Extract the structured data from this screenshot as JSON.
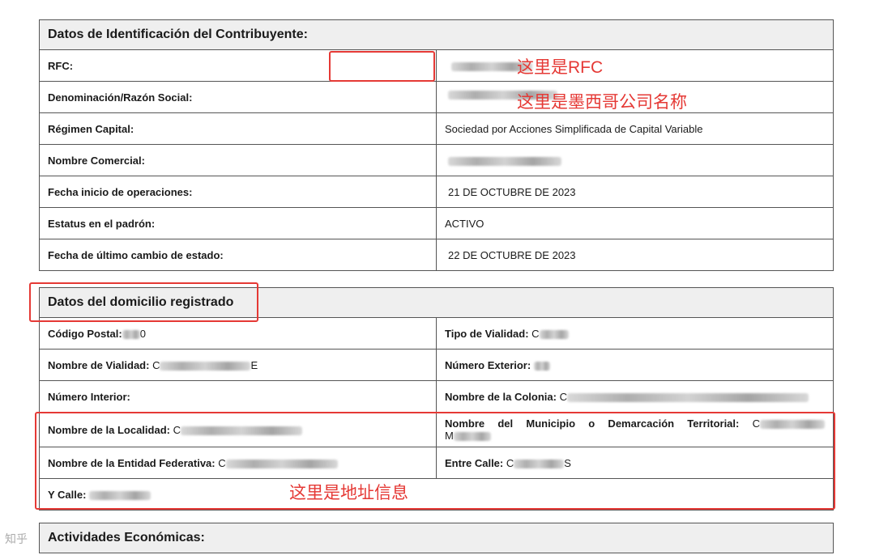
{
  "section1": {
    "title": "Datos de Identificación del Contribuyente:",
    "rows": [
      {
        "label": "RFC:",
        "value": ""
      },
      {
        "label": "Denominación/Razón Social:",
        "value": ""
      },
      {
        "label": "Régimen Capital:",
        "value": "Sociedad por Acciones Simplificada de Capital Variable"
      },
      {
        "label": "Nombre Comercial:",
        "value": ""
      },
      {
        "label": "Fecha inicio de operaciones:",
        "value": "21 DE OCTUBRE DE 2023"
      },
      {
        "label": "Estatus en el padrón:",
        "value": "ACTIVO"
      },
      {
        "label": "Fecha de último cambio de estado:",
        "value": "22 DE OCTUBRE DE 2023"
      }
    ]
  },
  "section2": {
    "title": "Datos del domicilio registrado",
    "rows": [
      {
        "left_label": "Código Postal:",
        "left_value": "0",
        "right_label": "Tipo de Vialidad:",
        "right_value": "C"
      },
      {
        "left_label": "Nombre de Vialidad:",
        "left_value": "C",
        "left_suffix": "E",
        "right_label": "Número Exterior:",
        "right_value": ""
      },
      {
        "left_label": "Número Interior:",
        "left_value": "",
        "right_label": "Nombre de la Colonia:",
        "right_value": "C"
      },
      {
        "left_label": "Nombre de la Localidad:",
        "left_value": "C",
        "right_label": "Nombre del Municipio o Demarcación Territorial:",
        "right_value": "C",
        "right_line2": "M"
      },
      {
        "left_label": "Nombre de la Entidad Federativa:",
        "left_value": "C",
        "right_label": "Entre Calle:",
        "right_value": "C",
        "right_suffix": "S"
      },
      {
        "left_label": "Y Calle:",
        "left_value": ""
      }
    ]
  },
  "section3": {
    "title": "Actividades Económicas:"
  },
  "annotations": {
    "rfc": "这里是RFC",
    "company": "这里是墨西哥公司名称",
    "address": "这里是地址信息",
    "color": "#e53935"
  },
  "watermark": "知乎"
}
